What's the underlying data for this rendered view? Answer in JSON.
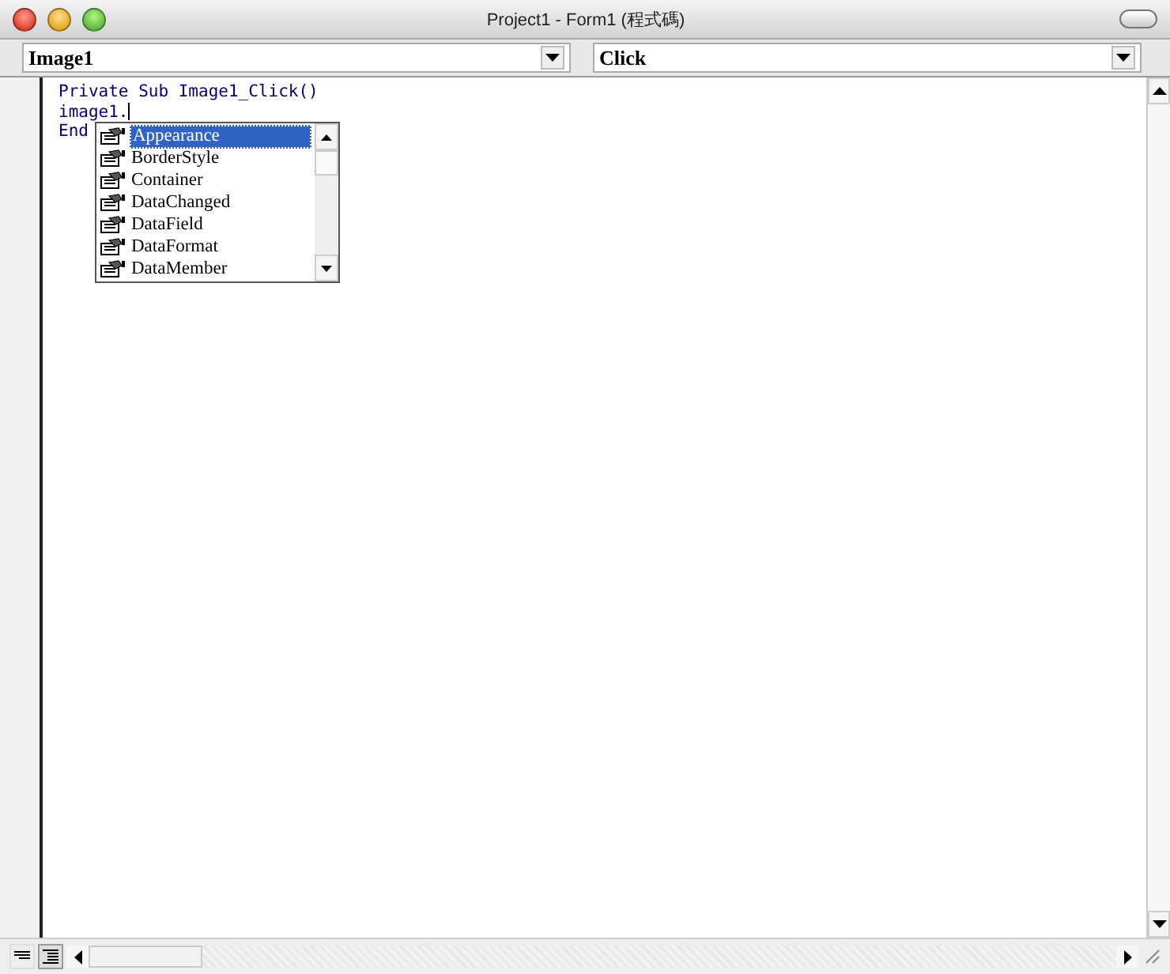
{
  "window": {
    "title": "Project1 - Form1 (程式碼)"
  },
  "object_dropdown": {
    "value": "Image1"
  },
  "procedure_dropdown": {
    "value": "Click"
  },
  "code_lines": [
    "Private Sub Image1_Click()",
    "image1.",
    "End"
  ],
  "autocomplete": {
    "items": [
      {
        "label": "Appearance",
        "selected": true
      },
      {
        "label": "BorderStyle",
        "selected": false
      },
      {
        "label": "Container",
        "selected": false
      },
      {
        "label": "DataChanged",
        "selected": false
      },
      {
        "label": "DataField",
        "selected": false
      },
      {
        "label": "DataFormat",
        "selected": false
      },
      {
        "label": "DataMember",
        "selected": false
      }
    ]
  }
}
